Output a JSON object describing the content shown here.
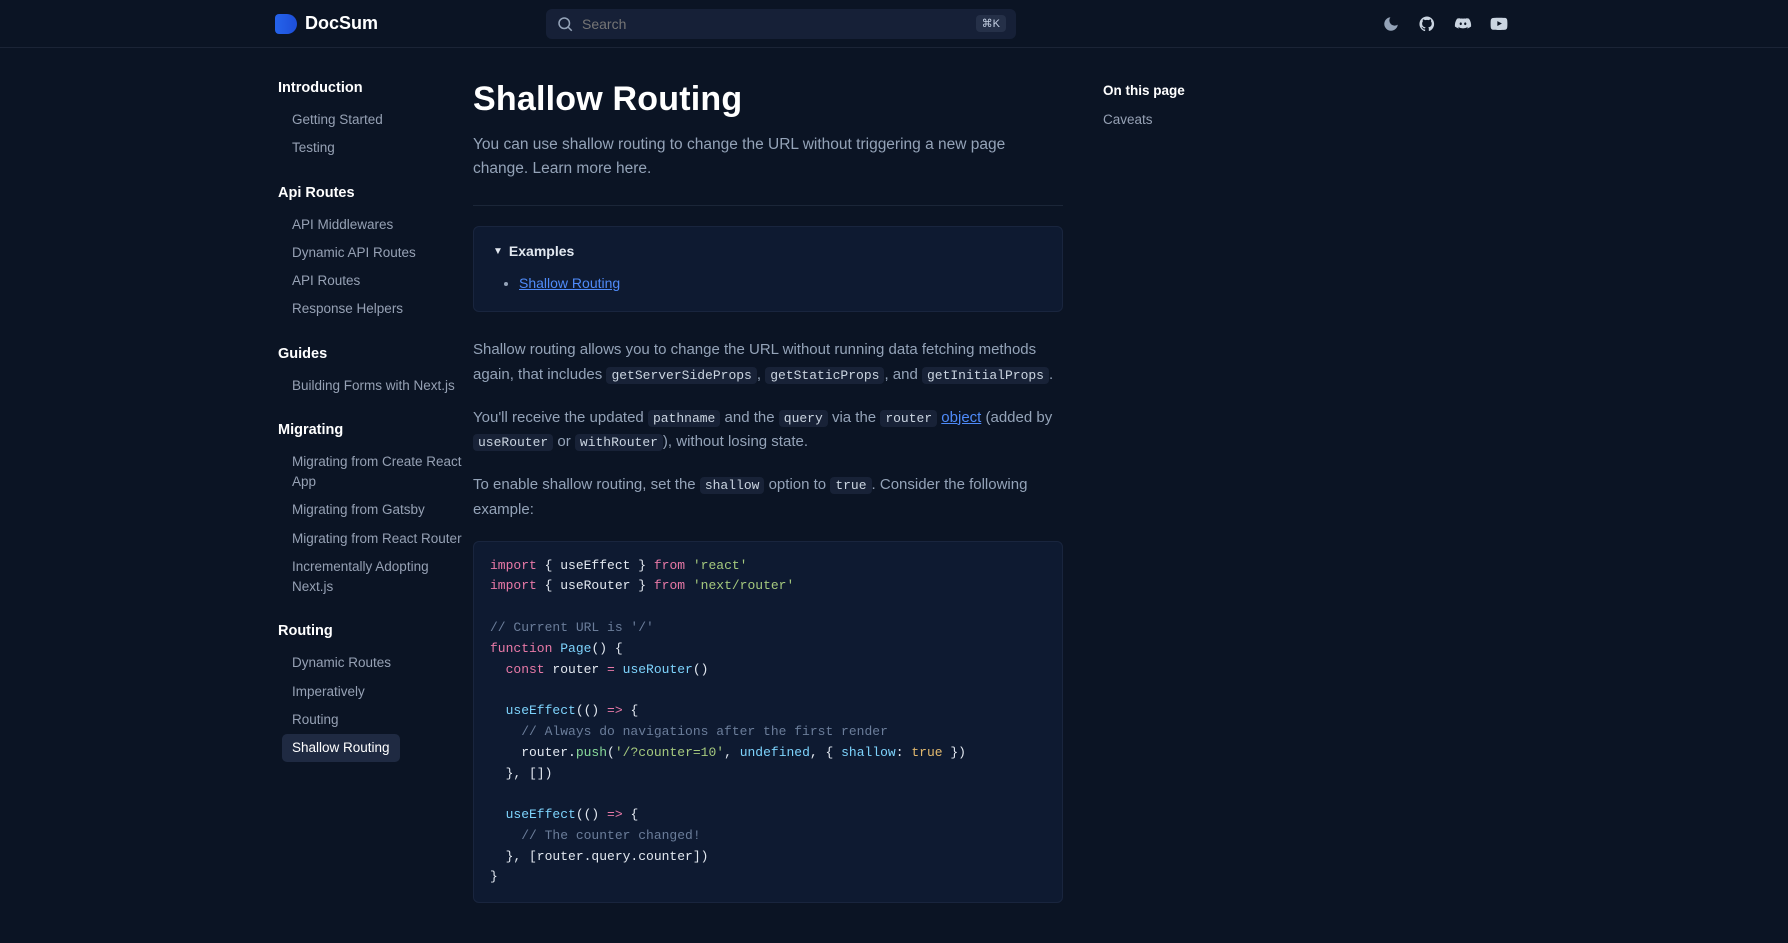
{
  "brand": "DocSum",
  "search": {
    "placeholder": "Search",
    "kbd": "⌘K"
  },
  "sidebar": {
    "sections": [
      {
        "title": "Introduction",
        "items": [
          "Getting Started",
          "Testing"
        ]
      },
      {
        "title": "Api Routes",
        "items": [
          "API Middlewares",
          "Dynamic API Routes",
          "API Routes",
          "Response Helpers"
        ]
      },
      {
        "title": "Guides",
        "items": [
          "Building Forms with Next.js"
        ]
      },
      {
        "title": "Migrating",
        "items": [
          "Migrating from Create React App",
          "Migrating from Gatsby",
          "Migrating from React Router",
          "Incrementally Adopting Next.js"
        ]
      },
      {
        "title": "Routing",
        "items": [
          "Dynamic Routes",
          "Imperatively",
          "Routing",
          "Shallow Routing"
        ]
      }
    ],
    "activeItem": "Shallow Routing"
  },
  "page": {
    "title": "Shallow Routing",
    "lead": "You can use shallow routing to change the URL without triggering a new page change. Learn more here.",
    "examples": {
      "header": "Examples",
      "link": "Shallow Routing"
    },
    "para1": {
      "t1": "Shallow routing allows you to change the URL without running data fetching methods again, that includes ",
      "c1": "getServerSideProps",
      "t2": ", ",
      "c2": "getStaticProps",
      "t3": ", and ",
      "c3": "getInitialProps",
      "t4": "."
    },
    "para2": {
      "t1": "You'll receive the updated ",
      "c1": "pathname",
      "t2": " and the ",
      "c2": "query",
      "t3": " via the ",
      "c3": "router",
      "link": "object",
      "t4": " (added by ",
      "c4": "useRouter",
      "t5": " or ",
      "c5": "withRouter",
      "t6": "), without losing state."
    },
    "para3": {
      "t1": "To enable shallow routing, set the ",
      "c1": "shallow",
      "t2": " option to ",
      "c2": "true",
      "t3": ". Consider the following example:"
    },
    "code": {
      "l1a": "import",
      "l1b": " { useEffect } ",
      "l1c": "from",
      "l1d": " 'react'",
      "l2a": "import",
      "l2b": " { useRouter } ",
      "l2c": "from",
      "l2d": " 'next/router'",
      "l4": "// Current URL is '/'",
      "l5a": "function",
      "l5b": " Page",
      "l5c": "() {",
      "l6a": "  const",
      "l6b": " router ",
      "l6c": "=",
      "l6d": " useRouter",
      "l6e": "()",
      "l8a": "  useEffect",
      "l8b": "(() ",
      "l8c": "=>",
      "l8d": " {",
      "l9": "    // Always do navigations after the first render",
      "l10a": "    router.",
      "l10b": "push",
      "l10c": "(",
      "l10d": "'/?counter=10'",
      "l10e": ", ",
      "l10f": "undefined",
      "l10g": ", { ",
      "l10h": "shallow",
      "l10i": ": ",
      "l10j": "true",
      "l10k": " })",
      "l11": "  }, [])",
      "l13a": "  useEffect",
      "l13b": "(() ",
      "l13c": "=>",
      "l13d": " {",
      "l14": "    // The counter changed!",
      "l15": "  }, [router.query.counter])",
      "l16": "}"
    }
  },
  "toc": {
    "title": "On this page",
    "items": [
      "Caveats"
    ]
  }
}
